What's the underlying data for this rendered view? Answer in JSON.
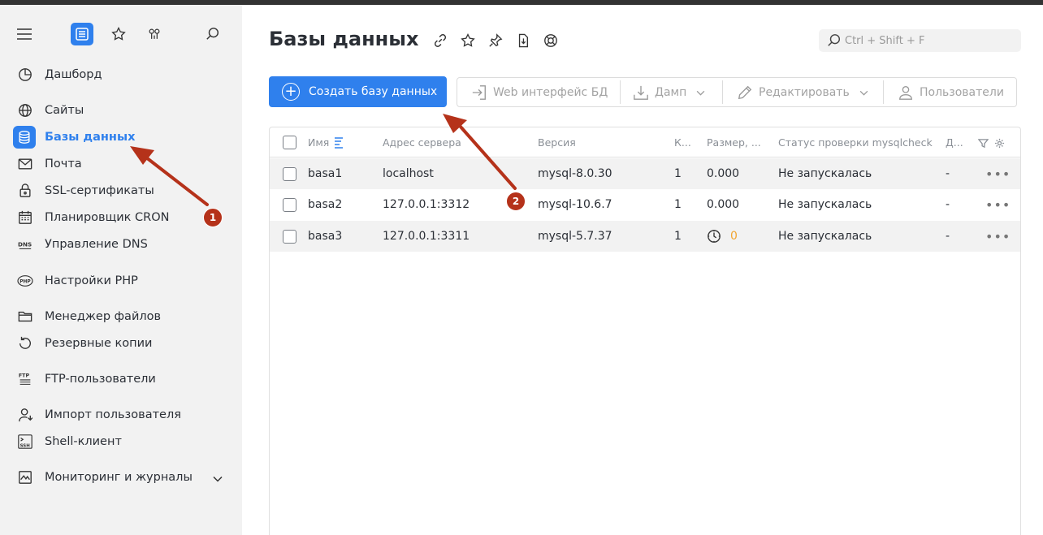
{
  "sidebar": {
    "items": [
      {
        "label": "Дашборд",
        "icon": "dashboard-icon"
      },
      {
        "label": "Сайты",
        "icon": "globe-icon"
      },
      {
        "label": "Базы данных",
        "icon": "database-icon",
        "active": true
      },
      {
        "label": "Почта",
        "icon": "mail-icon"
      },
      {
        "label": "SSL-сертификаты",
        "icon": "lock-icon"
      },
      {
        "label": "Планировщик CRON",
        "icon": "calendar-icon"
      },
      {
        "label": "Управление DNS",
        "icon": "dns-icon"
      },
      {
        "label": "Настройки PHP",
        "icon": "php-icon"
      },
      {
        "label": "Менеджер файлов",
        "icon": "folder-icon"
      },
      {
        "label": "Резервные копии",
        "icon": "backup-icon"
      },
      {
        "label": "FTP-пользователи",
        "icon": "ftp-icon"
      },
      {
        "label": "Импорт пользователя",
        "icon": "user-import-icon"
      },
      {
        "label": "Shell-клиент",
        "icon": "ssh-icon"
      },
      {
        "label": "Мониторинг и журналы",
        "icon": "monitoring-icon"
      }
    ]
  },
  "header": {
    "title": "Базы данных",
    "search_placeholder": "Ctrl + Shift + F"
  },
  "toolbar": {
    "create_label": "Создать базу данных",
    "web_label": "Web интерфейс БД",
    "dump_label": "Дамп",
    "edit_label": "Редактировать",
    "users_label": "Пользователи"
  },
  "table": {
    "columns": [
      "Имя",
      "Адрес сервера",
      "Версия",
      "К...",
      "Размер, ...",
      "Статус проверки mysqlcheck",
      "Д..."
    ],
    "rows": [
      {
        "name": "basa1",
        "address": "localhost",
        "version": "mysql-8.0.30",
        "count": "1",
        "size": "0.000",
        "status": "Не запускалась",
        "d": "-"
      },
      {
        "name": "basa2",
        "address": "127.0.0.1:3312",
        "version": "mysql-10.6.7",
        "count": "1",
        "size": "0.000",
        "status": "Не запускалась",
        "d": "-"
      },
      {
        "name": "basa3",
        "address": "127.0.0.1:3311",
        "version": "mysql-5.7.37",
        "count": "1",
        "size": "0",
        "status": "Не запускалась",
        "d": "-"
      }
    ]
  },
  "annotations": {
    "badge1": "1",
    "badge2": "2"
  },
  "colors": {
    "accent": "#2f80ed",
    "annotation": "#b5321a",
    "warning": "#f2a531"
  }
}
